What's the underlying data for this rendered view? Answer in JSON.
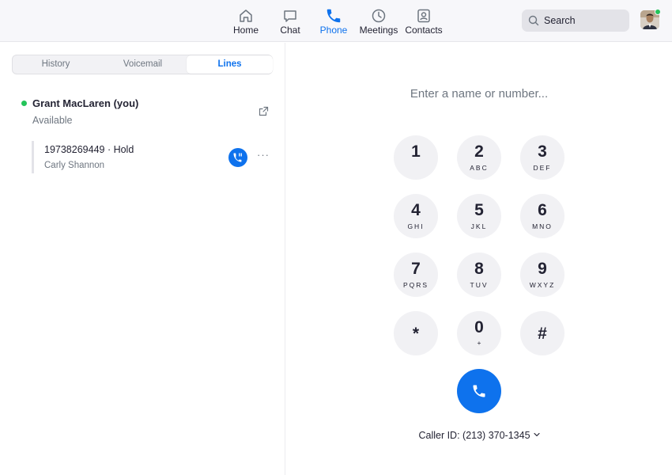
{
  "nav": {
    "items": [
      {
        "label": "Home",
        "icon": "home-icon"
      },
      {
        "label": "Chat",
        "icon": "chat-icon"
      },
      {
        "label": "Phone",
        "icon": "phone-icon",
        "active": true
      },
      {
        "label": "Meetings",
        "icon": "clock-icon"
      },
      {
        "label": "Contacts",
        "icon": "contacts-icon"
      }
    ],
    "search_label": "Search"
  },
  "tabs": [
    "History",
    "Voicemail",
    "Lines"
  ],
  "active_tab": "Lines",
  "user": {
    "name": "Grant MacLaren (you)",
    "status": "Available"
  },
  "call": {
    "number_status": "19738269449 · Hold",
    "contact": "Carly Shannon"
  },
  "dialer": {
    "placeholder": "Enter a name or number...",
    "keys": [
      {
        "digit": "1",
        "letters": ""
      },
      {
        "digit": "2",
        "letters": "ABC"
      },
      {
        "digit": "3",
        "letters": "DEF"
      },
      {
        "digit": "4",
        "letters": "GHI"
      },
      {
        "digit": "5",
        "letters": "JKL"
      },
      {
        "digit": "6",
        "letters": "MNO"
      },
      {
        "digit": "7",
        "letters": "PQRS"
      },
      {
        "digit": "8",
        "letters": "TUV"
      },
      {
        "digit": "9",
        "letters": "WXYZ"
      },
      {
        "digit": "*",
        "letters": ""
      },
      {
        "digit": "0",
        "letters": "+"
      },
      {
        "digit": "#",
        "letters": ""
      }
    ],
    "caller_id": "Caller ID: (213) 370-1345"
  },
  "colors": {
    "accent": "#0e72ed",
    "online": "#24c45a",
    "key_bg": "#f1f1f4"
  }
}
